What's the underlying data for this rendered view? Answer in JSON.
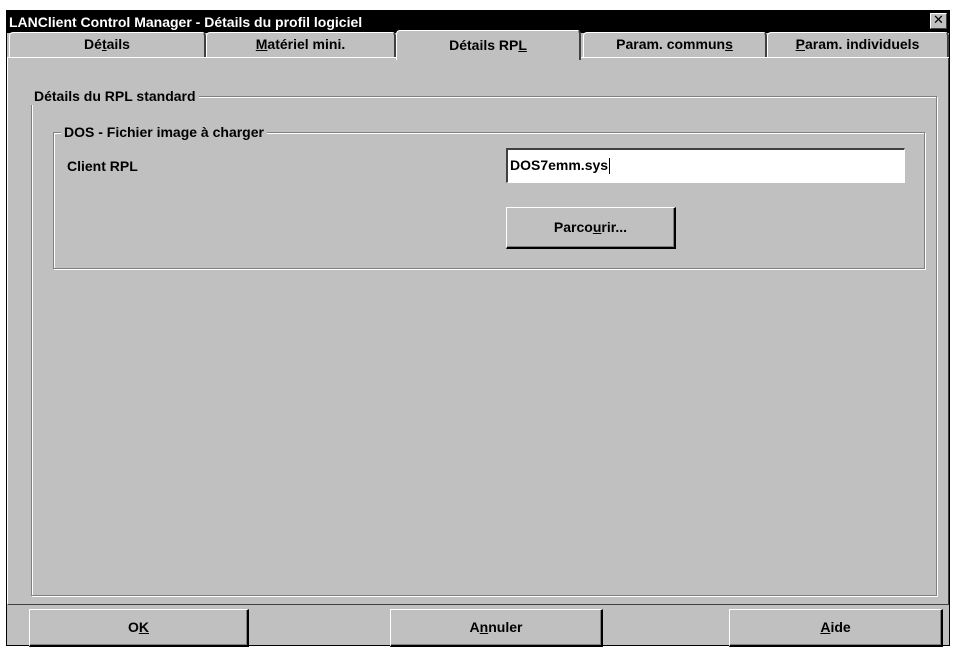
{
  "window": {
    "title": "LANClient Control Manager - Détails du profil logiciel",
    "close_glyph": "✕"
  },
  "tabs": [
    {
      "pre": "Dé",
      "mn": "t",
      "post": "ails",
      "active": false
    },
    {
      "pre": "",
      "mn": "M",
      "post": "atériel mini.",
      "active": false
    },
    {
      "pre": "Détails RP",
      "mn": "L",
      "post": "",
      "active": true
    },
    {
      "pre": "Param. commun",
      "mn": "s",
      "post": "",
      "active": false
    },
    {
      "pre": "",
      "mn": "P",
      "post": "aram. individuels",
      "active": false
    }
  ],
  "group_standard": {
    "legend": "Détails du RPL standard"
  },
  "group_dos": {
    "legend": "DOS - Fichier image à charger",
    "client_label": "Client RPL",
    "client_value": "DOS7emm.sys",
    "browse": {
      "pre": "Parco",
      "mn": "u",
      "post": "rir..."
    }
  },
  "footer": {
    "ok": {
      "pre": "O",
      "mn": "K",
      "post": ""
    },
    "cancel": {
      "pre": "A",
      "mn": "n",
      "post": "nuler"
    },
    "help": {
      "pre": "",
      "mn": "A",
      "post": "ide"
    }
  }
}
